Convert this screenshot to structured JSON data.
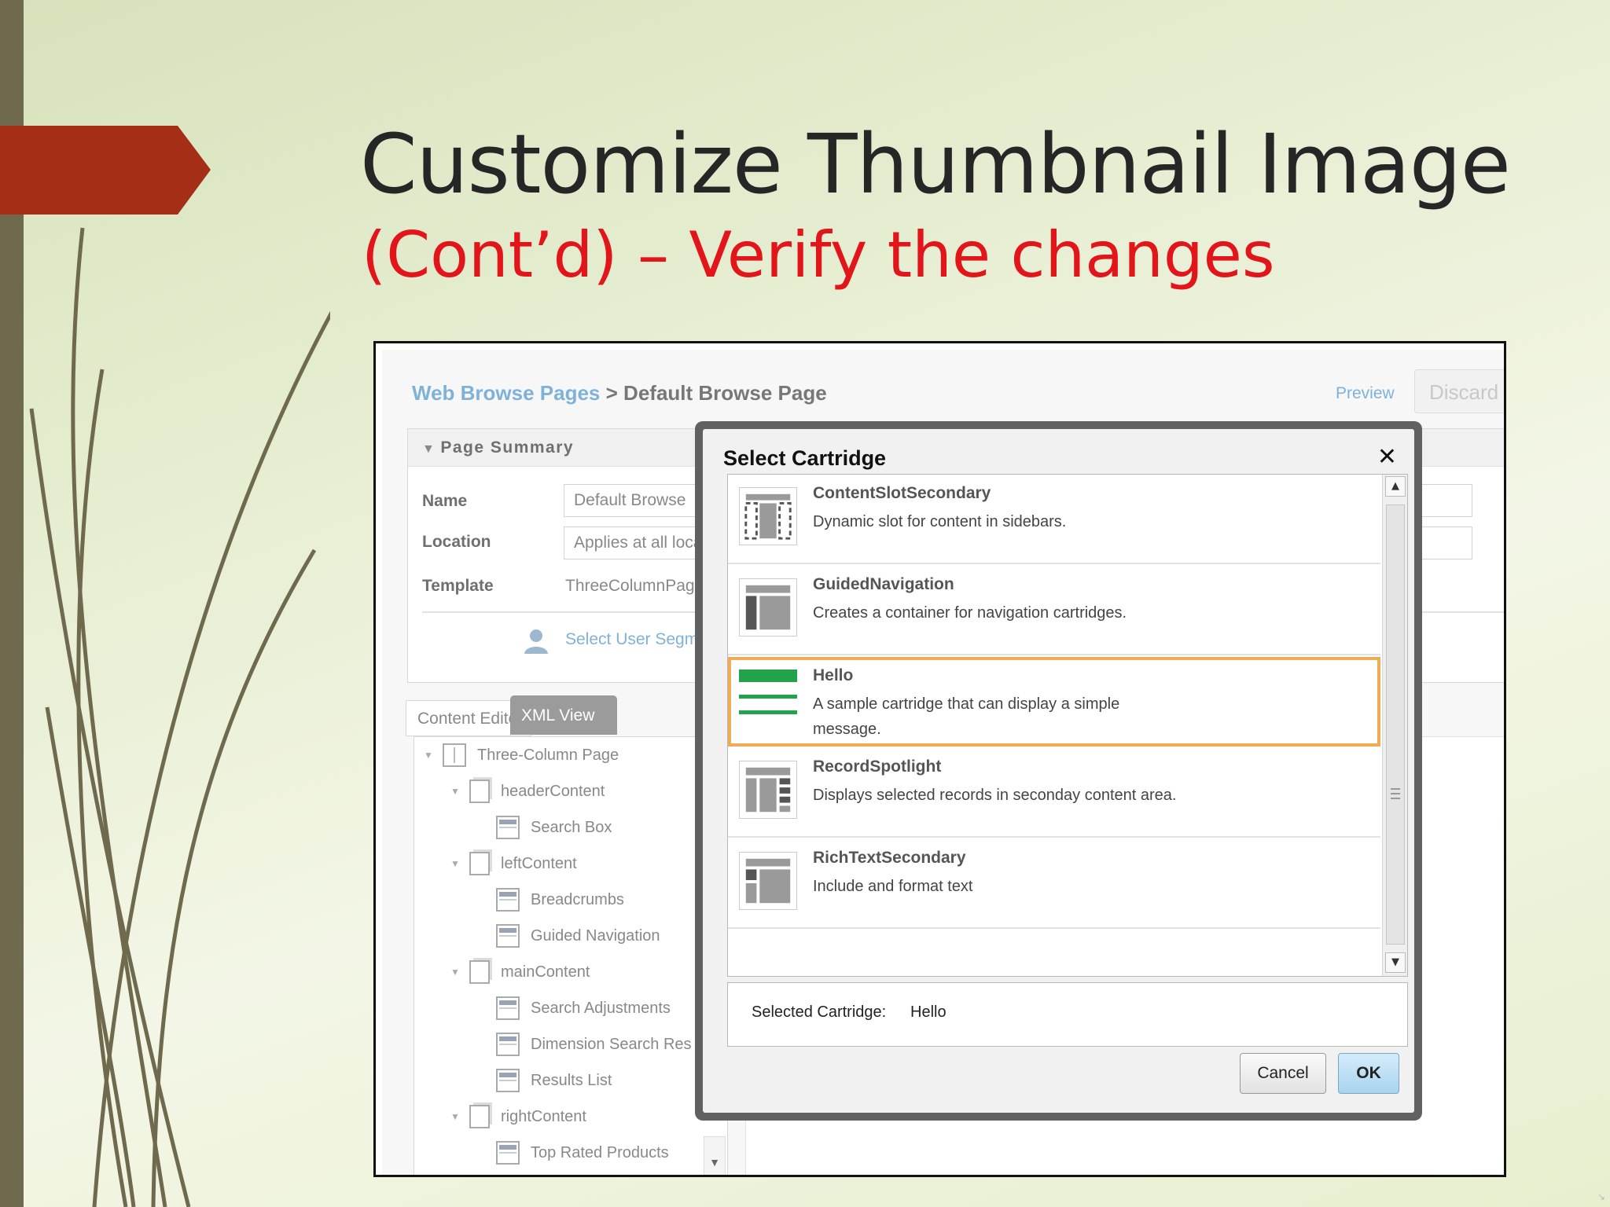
{
  "slide": {
    "title": "Customize Thumbnail Image",
    "subtitle": "(Cont’d) – Verify the changes"
  },
  "app": {
    "breadcrumb": {
      "parent": "Web Browse Pages",
      "separator": ">",
      "current": "Default Browse Page"
    },
    "preview_label": "Preview",
    "discard_label": "Discard",
    "page_summary": {
      "header": "Page Summary",
      "name_label": "Name",
      "name_value": "Default Browse",
      "location_label": "Location",
      "location_value": "Applies at all loca",
      "template_label": "Template",
      "template_value": "ThreeColumnPage",
      "user_segment_link": "Select User Segm"
    },
    "tabs": [
      "Content Editor",
      "XML View"
    ],
    "tree": [
      {
        "label": "Three-Column Page",
        "type": "page",
        "level": 0
      },
      {
        "label": "headerContent",
        "type": "folder",
        "level": 1
      },
      {
        "label": "Search Box",
        "type": "cartridge",
        "level": 2
      },
      {
        "label": "leftContent",
        "type": "folder",
        "level": 1
      },
      {
        "label": "Breadcrumbs",
        "type": "cartridge",
        "level": 2
      },
      {
        "label": "Guided Navigation",
        "type": "cartridge",
        "level": 2
      },
      {
        "label": "mainContent",
        "type": "folder",
        "level": 1
      },
      {
        "label": "Search Adjustments",
        "type": "cartridge",
        "level": 2
      },
      {
        "label": "Dimension Search Res",
        "type": "cartridge",
        "level": 2
      },
      {
        "label": "Results List",
        "type": "cartridge",
        "level": 2
      },
      {
        "label": "rightContent",
        "type": "folder",
        "level": 1
      },
      {
        "label": "Top Rated Products",
        "type": "cartridge",
        "level": 2
      }
    ]
  },
  "modal": {
    "title": "Select Cartridge",
    "close_icon": "close-icon",
    "cartridges": [
      {
        "name": "ContentSlotSecondary",
        "description": "Dynamic slot for content in sidebars.",
        "thumb": "sidebar-slots"
      },
      {
        "name": "GuidedNavigation",
        "description": "Creates a container for navigation cartridges.",
        "thumb": "left-nav"
      },
      {
        "name": "Hello",
        "description": "A sample cartridge that can display a simple message.",
        "thumb": "green-bars",
        "selected": true
      },
      {
        "name": "RecordSpotlight",
        "description": "Displays selected records in seconday content area.",
        "thumb": "record-grid"
      },
      {
        "name": "RichTextSecondary",
        "description": "Include and format text",
        "thumb": "rich-text"
      }
    ],
    "selected_label": "Selected Cartridge:",
    "selected_value": "Hello",
    "cancel_label": "Cancel",
    "ok_label": "OK"
  },
  "colors": {
    "title_red": "#e2151b",
    "arrow_red": "#a52e17",
    "link_blue": "#7fb2d8",
    "selection_orange": "#f0ac54",
    "hello_green": "#22a24a"
  }
}
